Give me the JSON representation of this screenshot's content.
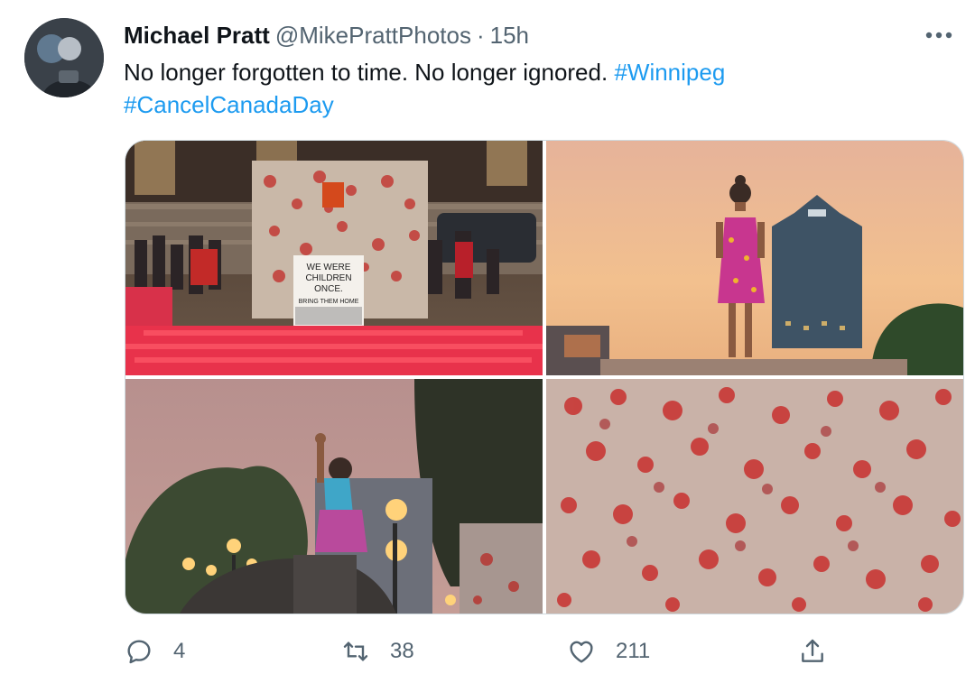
{
  "tweet": {
    "display_name": "Michael Pratt",
    "handle": "@MikePrattPhotos",
    "separator": "·",
    "time": "15h",
    "text_main": "No longer forgotten to time. No longer ignored. ",
    "hashtags": [
      "#Winnipeg",
      "#CancelCanadaDay"
    ]
  },
  "media": {
    "sign_line1": "WE WERE",
    "sign_line2": "CHILDREN",
    "sign_line3": "ONCE.",
    "sign_line4": "BRING THEM HOME"
  },
  "actions": {
    "reply_count": "4",
    "retweet_count": "38",
    "like_count": "211"
  },
  "colors": {
    "link": "#1d9bf0",
    "secondary_text": "#536471",
    "primary_text": "#0f1419"
  },
  "icons": [
    "more-icon",
    "reply-icon",
    "retweet-icon",
    "like-icon",
    "share-icon"
  ]
}
